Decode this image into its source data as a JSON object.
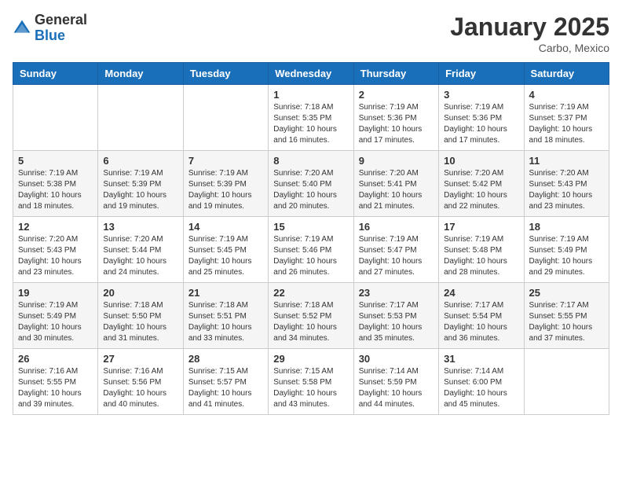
{
  "header": {
    "logo_general": "General",
    "logo_blue": "Blue",
    "title": "January 2025",
    "subtitle": "Carbo, Mexico"
  },
  "weekdays": [
    "Sunday",
    "Monday",
    "Tuesday",
    "Wednesday",
    "Thursday",
    "Friday",
    "Saturday"
  ],
  "weeks": [
    [
      {
        "day": "",
        "info": ""
      },
      {
        "day": "",
        "info": ""
      },
      {
        "day": "",
        "info": ""
      },
      {
        "day": "1",
        "info": "Sunrise: 7:18 AM\nSunset: 5:35 PM\nDaylight: 10 hours\nand 16 minutes."
      },
      {
        "day": "2",
        "info": "Sunrise: 7:19 AM\nSunset: 5:36 PM\nDaylight: 10 hours\nand 17 minutes."
      },
      {
        "day": "3",
        "info": "Sunrise: 7:19 AM\nSunset: 5:36 PM\nDaylight: 10 hours\nand 17 minutes."
      },
      {
        "day": "4",
        "info": "Sunrise: 7:19 AM\nSunset: 5:37 PM\nDaylight: 10 hours\nand 18 minutes."
      }
    ],
    [
      {
        "day": "5",
        "info": "Sunrise: 7:19 AM\nSunset: 5:38 PM\nDaylight: 10 hours\nand 18 minutes."
      },
      {
        "day": "6",
        "info": "Sunrise: 7:19 AM\nSunset: 5:39 PM\nDaylight: 10 hours\nand 19 minutes."
      },
      {
        "day": "7",
        "info": "Sunrise: 7:19 AM\nSunset: 5:39 PM\nDaylight: 10 hours\nand 19 minutes."
      },
      {
        "day": "8",
        "info": "Sunrise: 7:20 AM\nSunset: 5:40 PM\nDaylight: 10 hours\nand 20 minutes."
      },
      {
        "day": "9",
        "info": "Sunrise: 7:20 AM\nSunset: 5:41 PM\nDaylight: 10 hours\nand 21 minutes."
      },
      {
        "day": "10",
        "info": "Sunrise: 7:20 AM\nSunset: 5:42 PM\nDaylight: 10 hours\nand 22 minutes."
      },
      {
        "day": "11",
        "info": "Sunrise: 7:20 AM\nSunset: 5:43 PM\nDaylight: 10 hours\nand 23 minutes."
      }
    ],
    [
      {
        "day": "12",
        "info": "Sunrise: 7:20 AM\nSunset: 5:43 PM\nDaylight: 10 hours\nand 23 minutes."
      },
      {
        "day": "13",
        "info": "Sunrise: 7:20 AM\nSunset: 5:44 PM\nDaylight: 10 hours\nand 24 minutes."
      },
      {
        "day": "14",
        "info": "Sunrise: 7:19 AM\nSunset: 5:45 PM\nDaylight: 10 hours\nand 25 minutes."
      },
      {
        "day": "15",
        "info": "Sunrise: 7:19 AM\nSunset: 5:46 PM\nDaylight: 10 hours\nand 26 minutes."
      },
      {
        "day": "16",
        "info": "Sunrise: 7:19 AM\nSunset: 5:47 PM\nDaylight: 10 hours\nand 27 minutes."
      },
      {
        "day": "17",
        "info": "Sunrise: 7:19 AM\nSunset: 5:48 PM\nDaylight: 10 hours\nand 28 minutes."
      },
      {
        "day": "18",
        "info": "Sunrise: 7:19 AM\nSunset: 5:49 PM\nDaylight: 10 hours\nand 29 minutes."
      }
    ],
    [
      {
        "day": "19",
        "info": "Sunrise: 7:19 AM\nSunset: 5:49 PM\nDaylight: 10 hours\nand 30 minutes."
      },
      {
        "day": "20",
        "info": "Sunrise: 7:18 AM\nSunset: 5:50 PM\nDaylight: 10 hours\nand 31 minutes."
      },
      {
        "day": "21",
        "info": "Sunrise: 7:18 AM\nSunset: 5:51 PM\nDaylight: 10 hours\nand 33 minutes."
      },
      {
        "day": "22",
        "info": "Sunrise: 7:18 AM\nSunset: 5:52 PM\nDaylight: 10 hours\nand 34 minutes."
      },
      {
        "day": "23",
        "info": "Sunrise: 7:17 AM\nSunset: 5:53 PM\nDaylight: 10 hours\nand 35 minutes."
      },
      {
        "day": "24",
        "info": "Sunrise: 7:17 AM\nSunset: 5:54 PM\nDaylight: 10 hours\nand 36 minutes."
      },
      {
        "day": "25",
        "info": "Sunrise: 7:17 AM\nSunset: 5:55 PM\nDaylight: 10 hours\nand 37 minutes."
      }
    ],
    [
      {
        "day": "26",
        "info": "Sunrise: 7:16 AM\nSunset: 5:55 PM\nDaylight: 10 hours\nand 39 minutes."
      },
      {
        "day": "27",
        "info": "Sunrise: 7:16 AM\nSunset: 5:56 PM\nDaylight: 10 hours\nand 40 minutes."
      },
      {
        "day": "28",
        "info": "Sunrise: 7:15 AM\nSunset: 5:57 PM\nDaylight: 10 hours\nand 41 minutes."
      },
      {
        "day": "29",
        "info": "Sunrise: 7:15 AM\nSunset: 5:58 PM\nDaylight: 10 hours\nand 43 minutes."
      },
      {
        "day": "30",
        "info": "Sunrise: 7:14 AM\nSunset: 5:59 PM\nDaylight: 10 hours\nand 44 minutes."
      },
      {
        "day": "31",
        "info": "Sunrise: 7:14 AM\nSunset: 6:00 PM\nDaylight: 10 hours\nand 45 minutes."
      },
      {
        "day": "",
        "info": ""
      }
    ]
  ]
}
